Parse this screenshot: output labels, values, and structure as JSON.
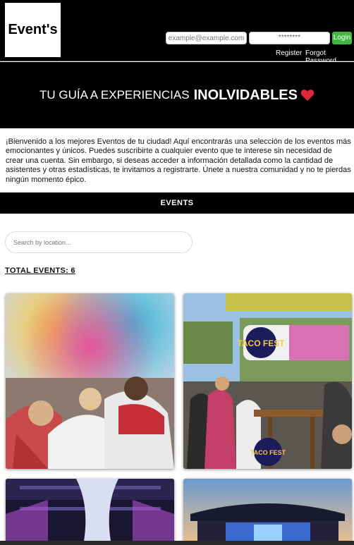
{
  "header": {
    "logo_text": "Event's",
    "email_placeholder": "example@example.com",
    "password_value": "********",
    "login_label": "Login",
    "register_label": "Register",
    "forgot_label": "Forgot Password"
  },
  "hero": {
    "text_regular": "TU GUÍA A EXPERIENCIAS",
    "text_bold": "INOLVIDABLES",
    "heart_icon": "heart-icon",
    "heart_color": "#e0243a"
  },
  "intro": {
    "text": "¡Bienvenido a los mejores Eventos de tu ciudad! Aquí encontrarás una selección de los eventos más emocionantes y únicos. Puedes suscribirte a cualquier evento que te interese sin necesidad de crear una cuenta. Sin embargo, si deseas acceder a información detallada como la cantidad de asistentes y otras estadísticas, te invitamos a registrarte. Únete a nuestra comunidad y no te pierdas ningún momento épico."
  },
  "events_section": {
    "title": "EVENTS",
    "search_placeholder": "Search by location...",
    "total_label": "TOTAL EVENTS: 6"
  },
  "cards": [
    {
      "image": "color-festival-photo"
    },
    {
      "image": "taco-fest-photo",
      "sign_text": "TACO FEST",
      "sign_text_2": "TACO FEST"
    },
    {
      "image": "stage-lights-photo"
    },
    {
      "image": "outdoor-stage-photo"
    }
  ],
  "colors": {
    "login_green": "#3fb83f",
    "header_bg": "#000000"
  }
}
